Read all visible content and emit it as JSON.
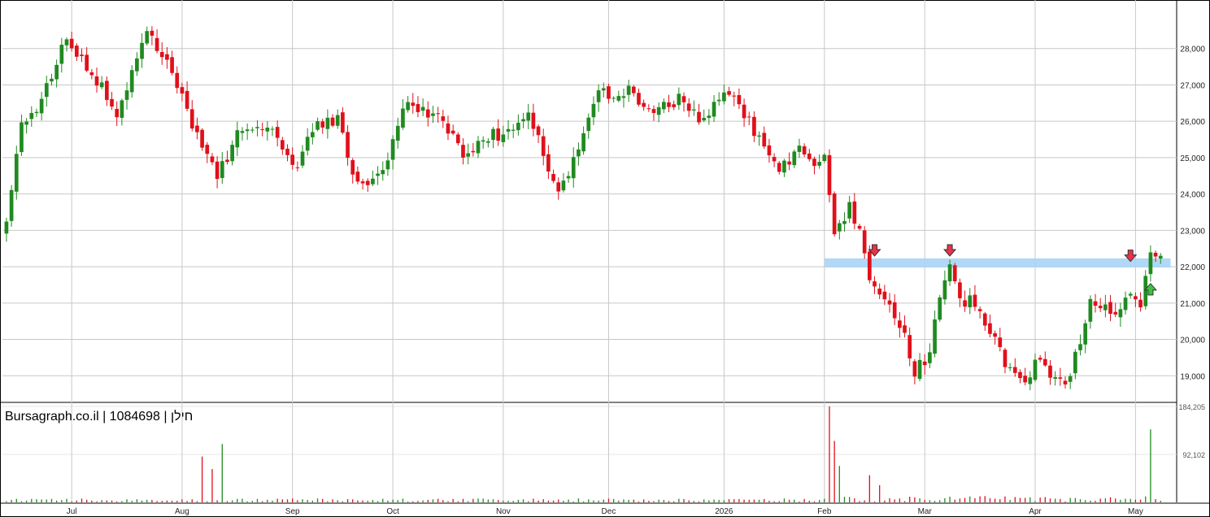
{
  "chart_data": {
    "type": "candlestick",
    "watermark": "Bursagraph.co.il | 1084698 | חילן",
    "price_axis": {
      "range": [
        18000,
        29000
      ],
      "ticks": [
        19000,
        20000,
        21000,
        22000,
        23000,
        24000,
        25000,
        26000,
        27000,
        28000
      ],
      "tick_labels": [
        "19,000",
        "20,000",
        "21,000",
        "22,000",
        "23,000",
        "24,000",
        "25,000",
        "26,000",
        "27,000",
        "28,000"
      ]
    },
    "volume_axis": {
      "max": 184205,
      "ticks": [
        92102,
        184205
      ],
      "tick_labels": [
        "92,102",
        "184,205"
      ]
    },
    "x_labels": [
      "Jul",
      "Aug",
      "Sep",
      "Oct",
      "Nov",
      "Dec",
      "2026",
      "Feb",
      "Mar",
      "Apr",
      "May"
    ],
    "x_label_index": [
      13,
      35,
      57,
      77,
      99,
      120,
      143,
      163,
      183,
      205,
      225
    ],
    "resistance_zone": {
      "low": 21980,
      "high": 22230,
      "from_index": 164,
      "to_index": 232
    },
    "markers": [
      {
        "type": "down-arrow",
        "index": 173,
        "price": 22450,
        "color": "#e8324a"
      },
      {
        "type": "down-arrow",
        "index": 188,
        "price": 22450,
        "color": "#e8324a"
      },
      {
        "type": "down-arrow",
        "index": 224,
        "price": 22300,
        "color": "#e8324a"
      },
      {
        "type": "up-arrow",
        "index": 228,
        "price": 21380,
        "color": "#3cc23c"
      }
    ],
    "colors": {
      "up": "#208a20",
      "down": "#e0101a",
      "zone": "#a8d4f5",
      "grid": "#c8c8c8"
    },
    "series": {
      "anchors": [
        [
          0,
          23200
        ],
        [
          3,
          25800
        ],
        [
          7,
          26500
        ],
        [
          12,
          28300
        ],
        [
          17,
          27400
        ],
        [
          22,
          26200
        ],
        [
          28,
          28500
        ],
        [
          33,
          27500
        ],
        [
          37,
          25800
        ],
        [
          42,
          24500
        ],
        [
          47,
          25900
        ],
        [
          52,
          25900
        ],
        [
          58,
          24800
        ],
        [
          62,
          26000
        ],
        [
          66,
          26000
        ],
        [
          70,
          24200
        ],
        [
          75,
          24600
        ],
        [
          80,
          26600
        ],
        [
          86,
          26100
        ],
        [
          91,
          25100
        ],
        [
          96,
          25600
        ],
        [
          100,
          25700
        ],
        [
          104,
          26300
        ],
        [
          107,
          25100
        ],
        [
          110,
          24200
        ],
        [
          114,
          25100
        ],
        [
          118,
          26800
        ],
        [
          124,
          26800
        ],
        [
          130,
          26300
        ],
        [
          134,
          26600
        ],
        [
          138,
          26000
        ],
        [
          143,
          26800
        ],
        [
          147,
          26200
        ],
        [
          150,
          25500
        ],
        [
          154,
          24600
        ],
        [
          158,
          25300
        ],
        [
          161,
          24700
        ],
        [
          163,
          25100
        ],
        [
          165,
          23000
        ],
        [
          168,
          23600
        ],
        [
          170,
          23000
        ],
        [
          172,
          21700
        ],
        [
          176,
          21000
        ],
        [
          179,
          20100
        ],
        [
          181,
          19100
        ],
        [
          184,
          19600
        ],
        [
          186,
          21200
        ],
        [
          188,
          21900
        ],
        [
          190,
          21100
        ],
        [
          193,
          21000
        ],
        [
          196,
          20300
        ],
        [
          200,
          19100
        ],
        [
          203,
          18900
        ],
        [
          206,
          19500
        ],
        [
          208,
          19000
        ],
        [
          211,
          18700
        ],
        [
          214,
          20000
        ],
        [
          216,
          21100
        ],
        [
          218,
          21000
        ],
        [
          221,
          20800
        ],
        [
          224,
          21200
        ],
        [
          226,
          20900
        ],
        [
          228,
          22400
        ],
        [
          230,
          22300
        ]
      ],
      "volume_spikes": [
        [
          39,
          88000
        ],
        [
          41,
          64000
        ],
        [
          43,
          112000
        ],
        [
          164,
          184205
        ],
        [
          165,
          118000
        ],
        [
          166,
          70000
        ],
        [
          172,
          52000
        ],
        [
          174,
          33000
        ],
        [
          228,
          140000
        ]
      ]
    }
  }
}
